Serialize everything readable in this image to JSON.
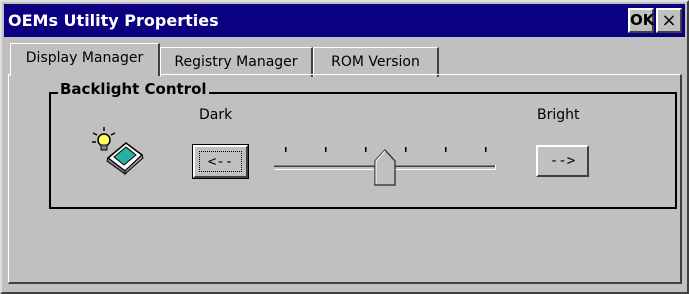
{
  "window": {
    "title": "OEMs Utility Properties",
    "ok_label": "OK",
    "close_label": "×"
  },
  "tabs": [
    {
      "label": "Display Manager",
      "selected": true
    },
    {
      "label": "Registry Manager",
      "selected": false
    },
    {
      "label": "ROM Version",
      "selected": false
    }
  ],
  "backlight": {
    "group_label": "Backlight Control",
    "dark_label": "Dark",
    "bright_label": "Bright",
    "decrease_label": "<--",
    "increase_label": "-->",
    "slider_ticks": 6,
    "slider_value": 0.5,
    "icon": "backlight-lightbulb-device-icon"
  },
  "colors": {
    "title_bar": "#0a0080",
    "face": "#c0c0c0"
  }
}
